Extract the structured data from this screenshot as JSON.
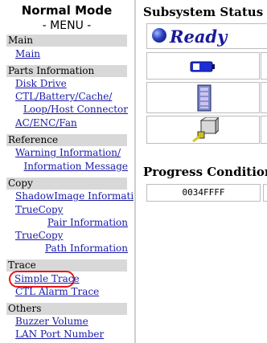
{
  "sidebar": {
    "title": "Normal Mode",
    "subtitle": "- MENU -",
    "sections": {
      "main": {
        "label": "Main",
        "links": {
          "main": "Main"
        }
      },
      "parts": {
        "label": "Parts Information",
        "links": {
          "disk_drive": "Disk Drive",
          "ctl_line1": "CTL/Battery/Cache/",
          "ctl_line2": "Loop/Host Connector",
          "ac_enc_fan": "AC/ENC/Fan"
        }
      },
      "reference": {
        "label": "Reference",
        "links": {
          "warning_line1": "Warning Information/",
          "warning_line2": "Information Message"
        }
      },
      "copy": {
        "label": "Copy",
        "links": {
          "shadowimage": "ShadowImage Information",
          "truecopy_pair_line1": "TrueCopy",
          "truecopy_pair_line2": "Pair Information",
          "truecopy_path_line1": "TrueCopy",
          "truecopy_path_line2": "Path Information"
        }
      },
      "trace": {
        "label": "Trace",
        "links": {
          "simple_trace": "Simple Trace",
          "ctl_alarm_trace": "CTL Alarm Trace"
        }
      },
      "others": {
        "label": "Others",
        "links": {
          "buzzer_volume": "Buzzer Volume",
          "lan_port_number": "LAN Port Number"
        }
      }
    },
    "highlight_color": "#e8141a",
    "link_color": "#1a1aa8"
  },
  "main": {
    "subsystem_status_title": "Subsystem Status",
    "status_text": "Ready",
    "status_color": "#1a1a9a",
    "icons": [
      "battery-icon",
      "disk-drive-icon",
      "host-connector-icon"
    ],
    "progress_title": "Progress Condition",
    "progress_value": "0034FFFF"
  }
}
